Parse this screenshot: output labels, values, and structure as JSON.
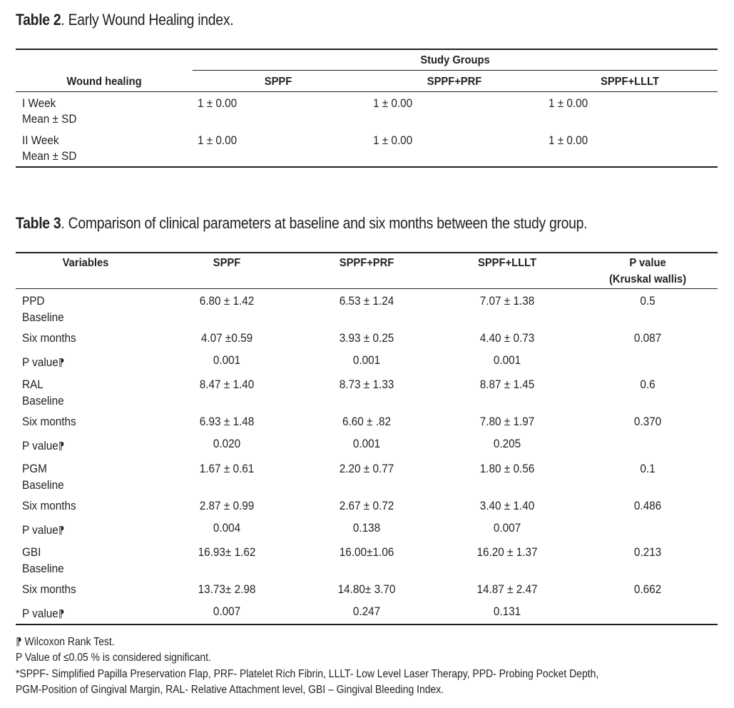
{
  "table2": {
    "label": "Table 2",
    "caption": ". Early Wound Healing index.",
    "group_header": "Study Groups",
    "columns": [
      "Wound healing",
      "SPPF",
      "SPPF+PRF",
      "SPPF+LLLT"
    ],
    "rows": [
      {
        "line1": "I Week",
        "line2": "Mean ± SD",
        "values": [
          "1 ± 0.00",
          "1 ± 0.00",
          "1 ± 0.00"
        ]
      },
      {
        "line1": "II Week",
        "line2": "Mean ± SD",
        "values": [
          "1 ± 0.00",
          "1 ± 0.00",
          "1 ± 0.00"
        ]
      }
    ]
  },
  "table3": {
    "label": "Table 3",
    "caption": ". Comparison of clinical parameters at baseline and six months between the study group.",
    "columns": [
      "Variables",
      "SPPF",
      "SPPF+PRF",
      "SPPF+LLLT",
      "P value",
      "(Kruskal wallis)"
    ],
    "groups": [
      {
        "name": "PPD",
        "baseline_label": "Baseline",
        "baseline": [
          "6.80 ± 1.42",
          "6.53 ± 1.24",
          "7.07 ± 1.38",
          "0.5"
        ],
        "six_label": "Six months",
        "six": [
          "4.07 ±0.59",
          "3.93 ± 0.25",
          "4.40 ± 0.73",
          "0.087"
        ],
        "p_label": "P value",
        "p": [
          "0.001",
          "0.001",
          "0.001"
        ]
      },
      {
        "name": "RAL",
        "baseline_label": "Baseline",
        "baseline": [
          "8.47 ± 1.40",
          "8.73 ± 1.33",
          "8.87 ± 1.45",
          "0.6"
        ],
        "six_label": "Six months",
        "six": [
          "6.93 ± 1.48",
          "6.60 ± .82",
          "7.80 ± 1.97",
          "0.370"
        ],
        "p_label": "P value",
        "p": [
          "0.020",
          "0.001",
          "0.205"
        ]
      },
      {
        "name": "PGM",
        "baseline_label": "Baseline",
        "baseline": [
          "1.67 ± 0.61",
          "2.20 ± 0.77",
          "1.80 ± 0.56",
          "0.1"
        ],
        "six_label": "Six months",
        "six": [
          "2.87 ± 0.99",
          "2.67 ± 0.72",
          "3.40 ± 1.40",
          "0.486"
        ],
        "p_label": "P value",
        "p": [
          "0.004",
          "0.138",
          "0.007"
        ]
      },
      {
        "name": "GBI",
        "baseline_label": "Baseline",
        "baseline": [
          "16.93± 1.62",
          "16.00±1.06",
          "16.20 ± 1.37",
          "0.213"
        ],
        "six_label": "Six months",
        "six": [
          "13.73± 2.98",
          "14.80± 3.70",
          "14.87 ± 2.47",
          "0.662"
        ],
        "p_label": "P value",
        "p": [
          "0.007",
          "0.247",
          "0.131"
        ]
      }
    ],
    "p_symbol": "⁋"
  },
  "footnotes": [
    " Wilcoxon Rank Test.",
    "P Value of ≤0.05 % is considered significant.",
    "*SPPF- Simplified Papilla Preservation Flap, PRF- Platelet Rich Fibrin, LLLT- Low Level Laser Therapy, PPD- Probing Pocket Depth,",
    "PGM-Position of Gingival Margin, RAL- Relative Attachment level, GBI – Gingival Bleeding Index."
  ]
}
